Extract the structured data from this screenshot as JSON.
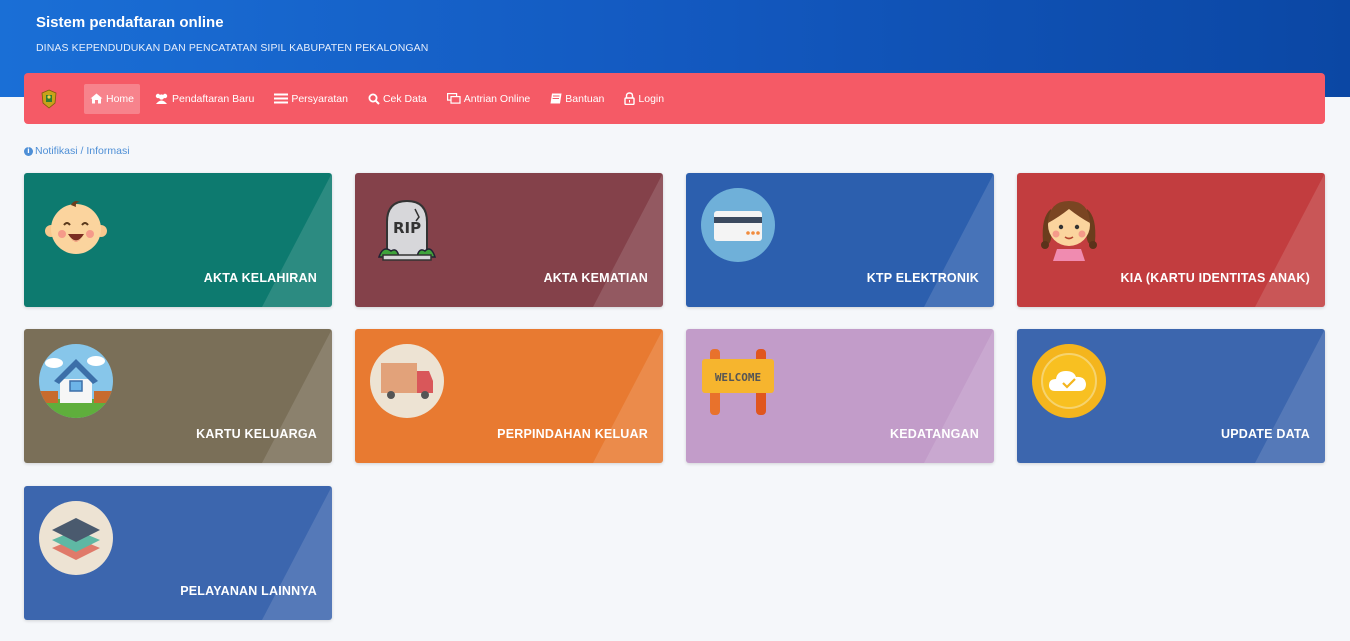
{
  "header": {
    "title": "Sistem pendaftaran online",
    "subtitle": "DINAS KEPENDUDUKAN DAN PENCATATAN SIPIL KABUPATEN PEKALONGAN"
  },
  "nav": {
    "items": [
      {
        "label": "Home",
        "icon": "home-icon"
      },
      {
        "label": "Pendaftaran Baru",
        "icon": "users-icon"
      },
      {
        "label": "Persyaratan",
        "icon": "list-icon"
      },
      {
        "label": "Cek Data",
        "icon": "search-icon"
      },
      {
        "label": "Antrian Online",
        "icon": "queue-icon"
      },
      {
        "label": "Bantuan",
        "icon": "book-icon"
      },
      {
        "label": "Login",
        "icon": "lock-icon"
      }
    ]
  },
  "notice": {
    "text": "Notifikasi / Informasi"
  },
  "cards": [
    {
      "label": "AKTA KELAHIRAN",
      "color": "#0d7a6f",
      "icon": "baby-icon"
    },
    {
      "label": "AKTA KEMATIAN",
      "color": "#84414a",
      "icon": "tombstone-icon"
    },
    {
      "label": "KTP ELEKTRONIK",
      "color": "#2c5fae",
      "icon": "id-card-icon"
    },
    {
      "label": "KIA (KARTU IDENTITAS ANAK)",
      "color": "#c23d3f",
      "icon": "girl-icon"
    },
    {
      "label": "KARTU KELUARGA",
      "color": "#7a6f58",
      "icon": "house-icon"
    },
    {
      "label": "PERPINDAHAN KELUAR",
      "color": "#e87a31",
      "icon": "truck-icon"
    },
    {
      "label": "KEDATANGAN",
      "color": "#c29cc9",
      "icon": "welcome-sign-icon"
    },
    {
      "label": "UPDATE DATA",
      "color": "#3c66ae",
      "icon": "cloud-check-icon"
    },
    {
      "label": "PELAYANAN LAINNYA",
      "color": "#3c66ae",
      "icon": "layers-icon"
    }
  ]
}
